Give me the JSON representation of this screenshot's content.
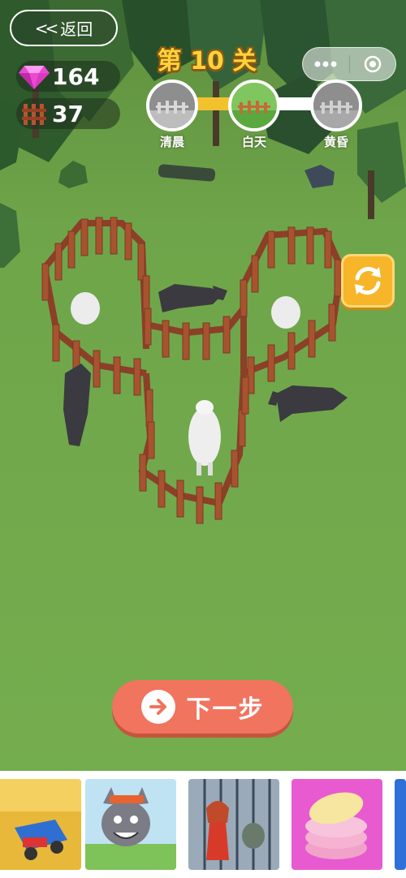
{
  "header": {
    "back_label": "返回",
    "level_title": "第 10 关"
  },
  "counters": {
    "gems": "164",
    "fences": "37"
  },
  "stages": [
    {
      "label": "清晨",
      "state": "done"
    },
    {
      "label": "白天",
      "state": "current"
    },
    {
      "label": "黄昏",
      "state": "locked"
    }
  ],
  "progress_fraction": 0.35,
  "actions": {
    "next_label": "下一步"
  },
  "ads": [
    {
      "icon": "harvester-game-icon"
    },
    {
      "icon": "wolf-cartoon-game-icon"
    },
    {
      "icon": "girl-escape-game-icon"
    },
    {
      "icon": "donut-game-icon"
    }
  ],
  "colors": {
    "grass": "#6fa54a",
    "title_gold": "#ffd23c",
    "next_button": "#f0745e",
    "refresh_button": "#f7b52a"
  }
}
